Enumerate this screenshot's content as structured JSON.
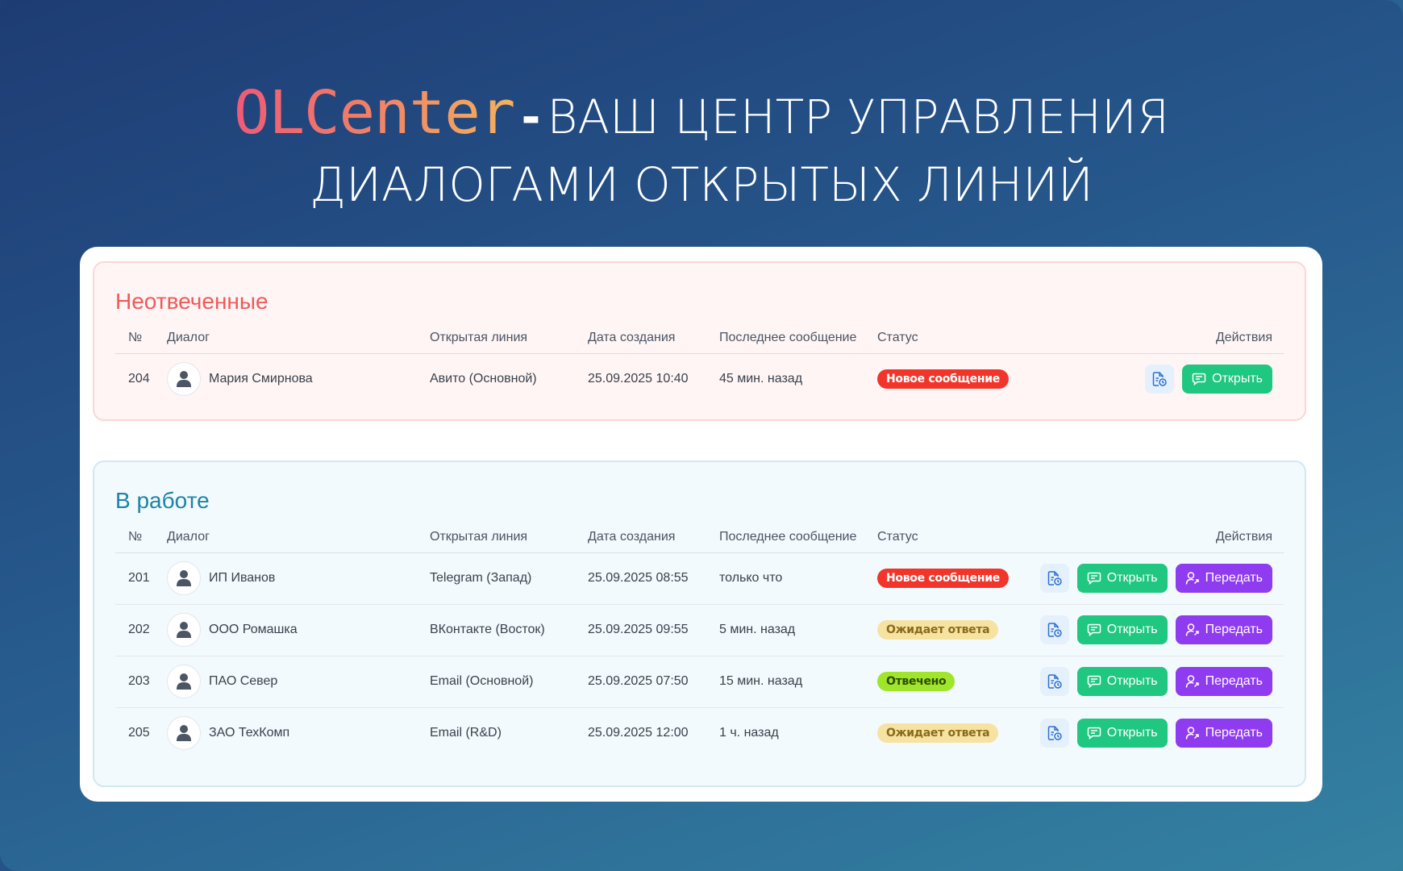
{
  "hero": {
    "brand": "OLCenter",
    "dash": "-",
    "line1_rest": "ВАШ ЦЕНТР УПРАВЛЕНИЯ",
    "line2": "ДИАЛОГАМИ ОТКРЫТЫХ ЛИНИЙ"
  },
  "columns": {
    "num": "№",
    "dialog": "Диалог",
    "line": "Открытая линия",
    "created": "Дата создания",
    "last": "Последнее сообщение",
    "status": "Статус",
    "actions": "Действия"
  },
  "buttons": {
    "open": "Открыть",
    "pass": "Передать"
  },
  "unanswered": {
    "title": "Неотвеченные",
    "rows": [
      {
        "num": "204",
        "name": "Мария Смирнова",
        "line": "Авито (Основной)",
        "created": "25.09.2025 10:40",
        "last": "45 мин. назад",
        "status": "Новое сообщение"
      }
    ]
  },
  "in_work": {
    "title": "В работе",
    "rows": [
      {
        "num": "201",
        "name": "ИП Иванов",
        "line": "Telegram (Запад)",
        "created": "25.09.2025 08:55",
        "last": "только что",
        "status": "Новое сообщение"
      },
      {
        "num": "202",
        "name": "ООО Ромашка",
        "line": "ВКонтакте (Восток)",
        "created": "25.09.2025 09:55",
        "last": "5 мин. назад",
        "status": "Ожидает ответа"
      },
      {
        "num": "203",
        "name": "ПАО Север",
        "line": "Email (Основной)",
        "created": "25.09.2025 07:50",
        "last": "15 мин. назад",
        "status": "Отвечено"
      },
      {
        "num": "205",
        "name": "ЗАО ТехКомп",
        "line": "Email (R&D)",
        "created": "25.09.2025 12:00",
        "last": "1 ч. назад",
        "status": "Ожидает ответа"
      }
    ]
  },
  "colors": {
    "new": "#f1352a",
    "wait": "#f6e3a1",
    "done": "#9fe52b",
    "open_btn": "#1fc780",
    "pass_btn": "#8f3cf0"
  }
}
